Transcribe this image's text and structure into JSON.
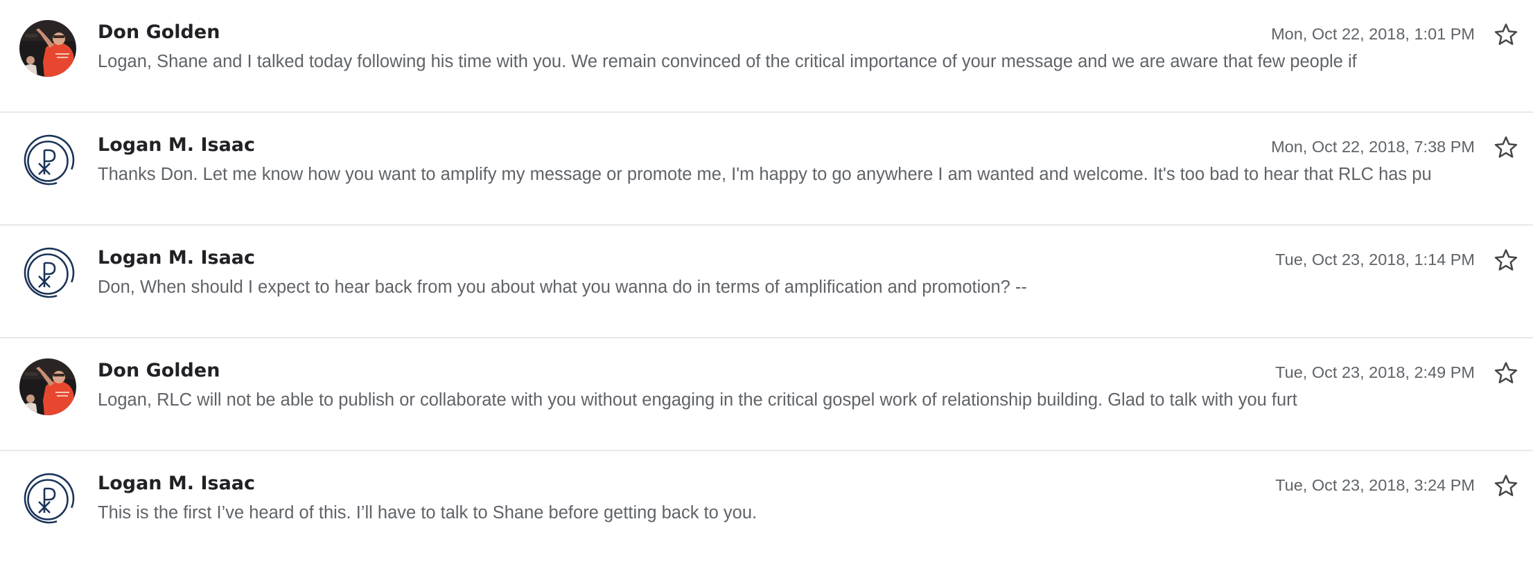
{
  "thread": {
    "messages": [
      {
        "sender": "Don Golden",
        "avatar": "photo-avatar",
        "date": "Mon, Oct 22, 2018, 1:01 PM",
        "snippet": "Logan, Shane and I talked today following his time with you. We remain convinced of the critical importance of your message and we are aware that few people if"
      },
      {
        "sender": "Logan M. Isaac",
        "avatar": "chi-rho-logo-avatar",
        "date": "Mon, Oct 22, 2018, 7:38 PM",
        "snippet": "Thanks Don. Let me know how you want to amplify my message or promote me, I'm happy to go anywhere I am wanted and welcome. It's too bad to hear that RLC has pu"
      },
      {
        "sender": "Logan M. Isaac",
        "avatar": "chi-rho-logo-avatar",
        "date": "Tue, Oct 23, 2018, 1:14 PM",
        "snippet": "Don, When should I expect to hear back from you about what you wanna do in terms of amplification and promotion? --"
      },
      {
        "sender": "Don Golden",
        "avatar": "photo-avatar",
        "date": "Tue, Oct 23, 2018, 2:49 PM",
        "snippet": "Logan, RLC will not be able to publish or collaborate with you without engaging in the critical gospel work of relationship building. Glad to talk with you furt"
      },
      {
        "sender": "Logan M. Isaac",
        "avatar": "chi-rho-logo-avatar",
        "date": "Tue, Oct 23, 2018, 3:24 PM",
        "snippet": "This is the first I’ve heard of this. I’ll have to talk to Shane before getting back to you."
      }
    ]
  },
  "icons": {
    "star": "star-outline-icon"
  },
  "colors": {
    "sender_text": "#202124",
    "secondary_text": "#5f6368",
    "divider": "#e8e8e8",
    "logo_navy": "#1b3358",
    "photo_shirt_red": "#e8472f"
  }
}
